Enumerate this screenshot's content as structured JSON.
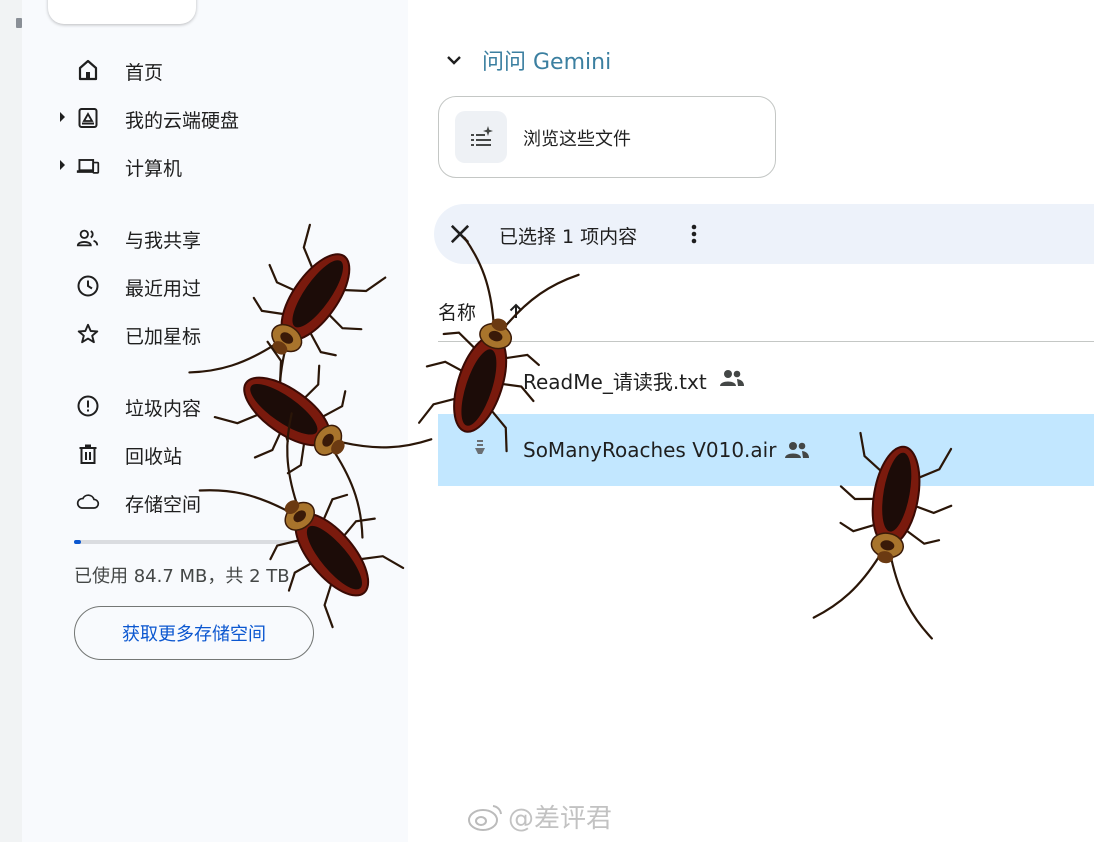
{
  "sidebar": {
    "nav_primary": [
      {
        "label": "首页",
        "icon": "home-icon"
      },
      {
        "label": "我的云端硬盘",
        "icon": "drive-icon"
      },
      {
        "label": "计算机",
        "icon": "computer-icon"
      }
    ],
    "nav_secondary": [
      {
        "label": "与我共享",
        "icon": "people-icon"
      },
      {
        "label": "最近用过",
        "icon": "clock-icon"
      },
      {
        "label": "已加星标",
        "icon": "star-icon"
      }
    ],
    "nav_tertiary": [
      {
        "label": "垃圾内容",
        "icon": "alert-circle-icon"
      },
      {
        "label": "回收站",
        "icon": "trash-icon"
      },
      {
        "label": "存储空间",
        "icon": "cloud-icon"
      }
    ],
    "storage": {
      "usage_text": "已使用 84.7 MB，共 2 TB",
      "used_fraction": 0.03,
      "button_label": "获取更多存储空间"
    }
  },
  "main": {
    "gemini_label": "问问 Gemini",
    "suggestion_label": "浏览这些文件",
    "selection_text": "已选择 1 项内容",
    "column_name": "名称",
    "files": [
      {
        "name": "ReadMe_请读我.txt",
        "shared": true,
        "selected": false
      },
      {
        "name": "SoManyRoaches V010.air",
        "shared": true,
        "selected": true
      }
    ]
  },
  "watermark": "@差评君",
  "colors": {
    "sidebar_bg": "#f8fafd",
    "selection_bar_bg": "#edf2fa",
    "selected_row_bg": "#c2e7ff",
    "gemini_text": "#3b7fa0",
    "link_blue": "#0b57d0"
  }
}
